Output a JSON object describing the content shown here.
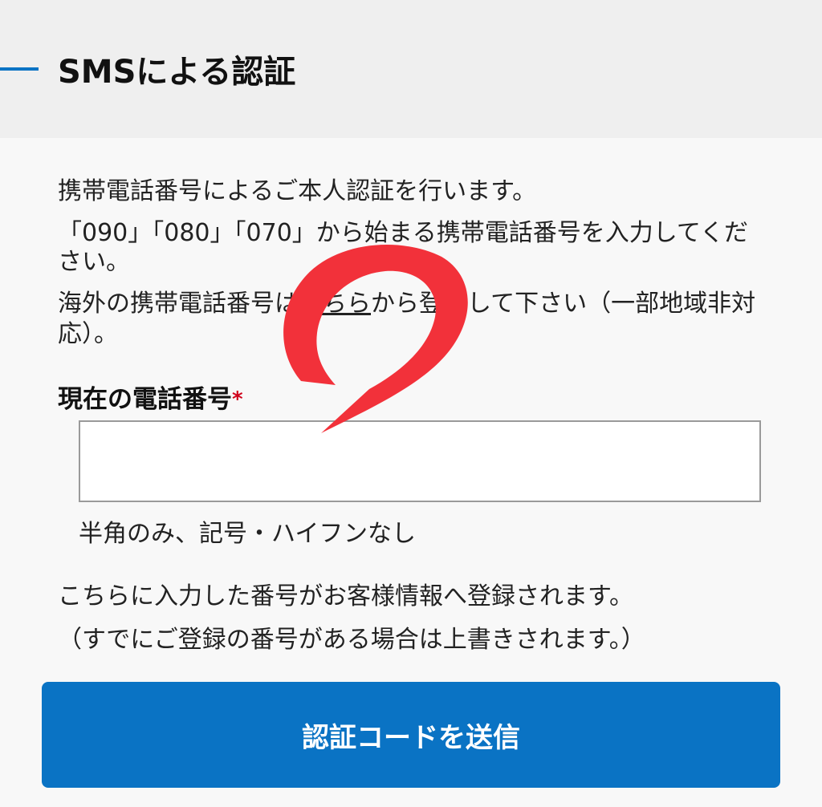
{
  "colors": {
    "accent": "#0a73c4",
    "button_bg": "#0a73c4",
    "required": "#d0021b",
    "scribble": "#f2313a"
  },
  "header": {
    "title": "SMSによる認証"
  },
  "intro": {
    "line1": "携帯電話番号によるご本人認証を行います。",
    "line2a": "「090」「080」「070」から始まる携帯電話番号を入力してくだ",
    "line2b": "さい。",
    "line3_pre": "海外の携帯電話番号は",
    "line3_link": "こちら",
    "line3_post": "から登録して下さい（一部地域非対",
    "line3b": "応）。"
  },
  "form": {
    "phone_label": "現在の電話番号",
    "required_mark": "*",
    "phone_value": "",
    "hint": "半角のみ、記号・ハイフンなし"
  },
  "notes": {
    "line1": "こちらに入力した番号がお客様情報へ登録されます。",
    "line2": "（すでにご登録の番号がある場合は上書きされます。）"
  },
  "submit": {
    "label": "認証コードを送信"
  },
  "overlay": {
    "scribble_icon": "red-marker-scribble-icon"
  }
}
